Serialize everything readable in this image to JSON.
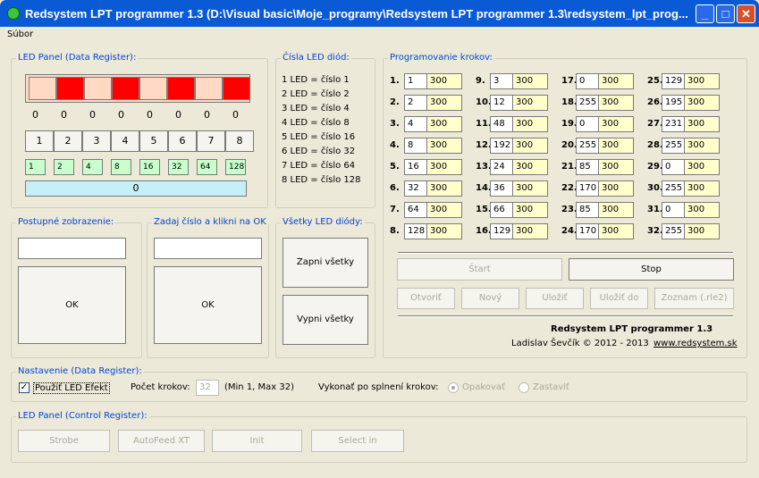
{
  "window": {
    "title": "Redsystem LPT programmer 1.3 (D:\\Visual basic\\Moje_programy\\Redsystem LPT programmer 1.3\\redsystem_lpt_prog..."
  },
  "menu": {
    "file": "Súbor"
  },
  "led_panel": {
    "title": "LED Panel (Data Register):",
    "led_states": [
      "off",
      "on",
      "off",
      "on",
      "off",
      "on",
      "off",
      "on"
    ],
    "colors": {
      "on": "#ff0000",
      "off": "#ffd9c4"
    },
    "values": [
      "0",
      "0",
      "0",
      "0",
      "0",
      "0",
      "0",
      "0"
    ],
    "buttons": [
      "1",
      "2",
      "3",
      "4",
      "5",
      "6",
      "7",
      "8"
    ],
    "bit_values": [
      "1",
      "2",
      "4",
      "8",
      "16",
      "32",
      "64",
      "128"
    ],
    "total": "0"
  },
  "led_numbers": {
    "title": "Čísla LED diód:",
    "items": [
      "1 LED = číslo 1",
      "2 LED = číslo 2",
      "3 LED = číslo 4",
      "4 LED = číslo 8",
      "5 LED = číslo 16",
      "6 LED = číslo 32",
      "7 LED = číslo 64",
      "8 LED = číslo 128"
    ]
  },
  "gradual": {
    "title": "Postupné zobrazenie:",
    "value": "",
    "ok": "OK"
  },
  "enter_number": {
    "title": "Zadaj číslo a klikni na OK",
    "value": "",
    "ok": "OK"
  },
  "all_leds": {
    "title": "Všetky LED diódy:",
    "on": "Zapni všetky",
    "off": "Vypni všetky"
  },
  "program": {
    "title": "Programovanie krokov:",
    "steps": [
      {
        "n": "1.",
        "v": "1",
        "t": "300"
      },
      {
        "n": "2.",
        "v": "2",
        "t": "300"
      },
      {
        "n": "3.",
        "v": "4",
        "t": "300"
      },
      {
        "n": "4.",
        "v": "8",
        "t": "300"
      },
      {
        "n": "5.",
        "v": "16",
        "t": "300"
      },
      {
        "n": "6.",
        "v": "32",
        "t": "300"
      },
      {
        "n": "7.",
        "v": "64",
        "t": "300"
      },
      {
        "n": "8.",
        "v": "128",
        "t": "300"
      },
      {
        "n": "9.",
        "v": "3",
        "t": "300"
      },
      {
        "n": "10.",
        "v": "12",
        "t": "300"
      },
      {
        "n": "11.",
        "v": "48",
        "t": "300"
      },
      {
        "n": "12.",
        "v": "192",
        "t": "300"
      },
      {
        "n": "13.",
        "v": "24",
        "t": "300"
      },
      {
        "n": "14.",
        "v": "36",
        "t": "300"
      },
      {
        "n": "15.",
        "v": "66",
        "t": "300"
      },
      {
        "n": "16.",
        "v": "129",
        "t": "300"
      },
      {
        "n": "17.",
        "v": "0",
        "t": "300"
      },
      {
        "n": "18.",
        "v": "255",
        "t": "300"
      },
      {
        "n": "19.",
        "v": "0",
        "t": "300"
      },
      {
        "n": "20.",
        "v": "255",
        "t": "300"
      },
      {
        "n": "21.",
        "v": "85",
        "t": "300"
      },
      {
        "n": "22.",
        "v": "170",
        "t": "300"
      },
      {
        "n": "23.",
        "v": "85",
        "t": "300"
      },
      {
        "n": "24.",
        "v": "170",
        "t": "300"
      },
      {
        "n": "25.",
        "v": "129",
        "t": "300"
      },
      {
        "n": "26.",
        "v": "195",
        "t": "300"
      },
      {
        "n": "27.",
        "v": "231",
        "t": "300"
      },
      {
        "n": "28.",
        "v": "255",
        "t": "300"
      },
      {
        "n": "29.",
        "v": "0",
        "t": "300"
      },
      {
        "n": "30.",
        "v": "255",
        "t": "300"
      },
      {
        "n": "31.",
        "v": "0",
        "t": "300"
      },
      {
        "n": "32.",
        "v": "255",
        "t": "300"
      }
    ],
    "start": "Štart",
    "stop": "Stop",
    "open": "Otvoriť",
    "new": "Nový",
    "save": "Uložiť",
    "save_to": "Uložiť do",
    "list": "Zoznam (.rle2)",
    "app_name": "Redsystem LPT programmer 1.3",
    "author": "Ladislav Ševčík © 2012 - 2013",
    "website": "www.redsystem.sk"
  },
  "settings": {
    "title": "Nastavenie (Data Register):",
    "use_effect": "Použiť LED Efekt",
    "step_count_label": "Počet krokov:",
    "step_count": "32",
    "range": "(Min 1, Max 32)",
    "action_label": "Vykonať po splnení krokov:",
    "repeat": "Opakovať",
    "stop": "Zastaviť"
  },
  "control": {
    "title": "LED Panel (Control Register):",
    "buttons": [
      "Strobe",
      "AutoFeed XT",
      "Init",
      "Select in"
    ]
  }
}
